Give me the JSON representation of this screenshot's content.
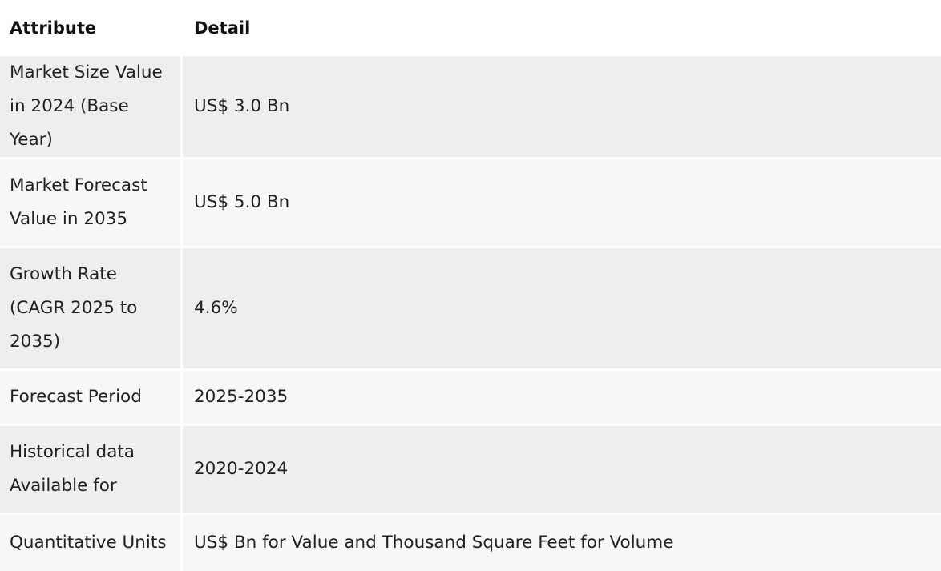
{
  "table": {
    "headers": [
      "Attribute",
      "Detail"
    ],
    "rows": [
      {
        "attribute": "Market Size Value in 2024 (Base Year)",
        "detail": "US$ 3.0 Bn"
      },
      {
        "attribute": "Market Forecast Value in 2035",
        "detail": "US$ 5.0 Bn"
      },
      {
        "attribute": "Growth Rate (CAGR 2025 to 2035)",
        "detail": "4.6%"
      },
      {
        "attribute": "Forecast Period",
        "detail": "2025-2035"
      },
      {
        "attribute": "Historical data Available for",
        "detail": "2020-2024"
      },
      {
        "attribute": "Quantitative Units",
        "detail": "US$ Bn for Value and Thousand Square Feet for Volume"
      }
    ]
  },
  "colors": {
    "row_odd": "#eeeeee",
    "row_even": "#f7f7f7",
    "header_bg": "#ffffff",
    "text": "#212121"
  }
}
